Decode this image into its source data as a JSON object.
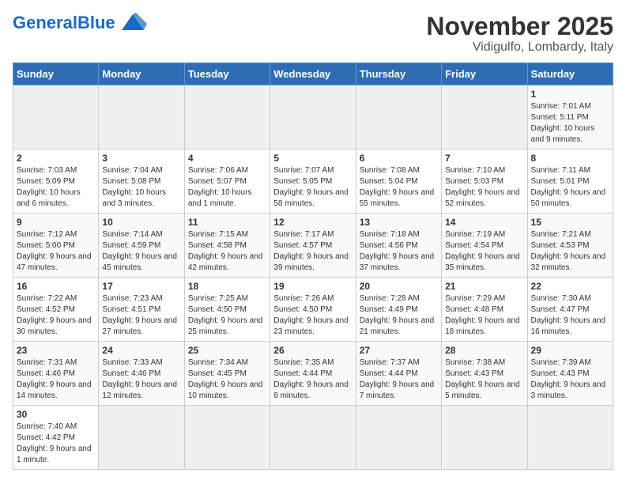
{
  "header": {
    "logo_general": "General",
    "logo_blue": "Blue",
    "title": "November 2025",
    "subtitle": "Vidigulfo, Lombardy, Italy"
  },
  "weekdays": [
    "Sunday",
    "Monday",
    "Tuesday",
    "Wednesday",
    "Thursday",
    "Friday",
    "Saturday"
  ],
  "weeks": [
    [
      {
        "day": "",
        "info": ""
      },
      {
        "day": "",
        "info": ""
      },
      {
        "day": "",
        "info": ""
      },
      {
        "day": "",
        "info": ""
      },
      {
        "day": "",
        "info": ""
      },
      {
        "day": "",
        "info": ""
      },
      {
        "day": "1",
        "info": "Sunrise: 7:01 AM\nSunset: 5:11 PM\nDaylight: 10 hours and 9 minutes."
      }
    ],
    [
      {
        "day": "2",
        "info": "Sunrise: 7:03 AM\nSunset: 5:09 PM\nDaylight: 10 hours and 6 minutes."
      },
      {
        "day": "3",
        "info": "Sunrise: 7:04 AM\nSunset: 5:08 PM\nDaylight: 10 hours and 3 minutes."
      },
      {
        "day": "4",
        "info": "Sunrise: 7:06 AM\nSunset: 5:07 PM\nDaylight: 10 hours and 1 minute."
      },
      {
        "day": "5",
        "info": "Sunrise: 7:07 AM\nSunset: 5:05 PM\nDaylight: 9 hours and 58 minutes."
      },
      {
        "day": "6",
        "info": "Sunrise: 7:08 AM\nSunset: 5:04 PM\nDaylight: 9 hours and 55 minutes."
      },
      {
        "day": "7",
        "info": "Sunrise: 7:10 AM\nSunset: 5:03 PM\nDaylight: 9 hours and 52 minutes."
      },
      {
        "day": "8",
        "info": "Sunrise: 7:11 AM\nSunset: 5:01 PM\nDaylight: 9 hours and 50 minutes."
      }
    ],
    [
      {
        "day": "9",
        "info": "Sunrise: 7:12 AM\nSunset: 5:00 PM\nDaylight: 9 hours and 47 minutes."
      },
      {
        "day": "10",
        "info": "Sunrise: 7:14 AM\nSunset: 4:59 PM\nDaylight: 9 hours and 45 minutes."
      },
      {
        "day": "11",
        "info": "Sunrise: 7:15 AM\nSunset: 4:58 PM\nDaylight: 9 hours and 42 minutes."
      },
      {
        "day": "12",
        "info": "Sunrise: 7:17 AM\nSunset: 4:57 PM\nDaylight: 9 hours and 39 minutes."
      },
      {
        "day": "13",
        "info": "Sunrise: 7:18 AM\nSunset: 4:56 PM\nDaylight: 9 hours and 37 minutes."
      },
      {
        "day": "14",
        "info": "Sunrise: 7:19 AM\nSunset: 4:54 PM\nDaylight: 9 hours and 35 minutes."
      },
      {
        "day": "15",
        "info": "Sunrise: 7:21 AM\nSunset: 4:53 PM\nDaylight: 9 hours and 32 minutes."
      }
    ],
    [
      {
        "day": "16",
        "info": "Sunrise: 7:22 AM\nSunset: 4:52 PM\nDaylight: 9 hours and 30 minutes."
      },
      {
        "day": "17",
        "info": "Sunrise: 7:23 AM\nSunset: 4:51 PM\nDaylight: 9 hours and 27 minutes."
      },
      {
        "day": "18",
        "info": "Sunrise: 7:25 AM\nSunset: 4:50 PM\nDaylight: 9 hours and 25 minutes."
      },
      {
        "day": "19",
        "info": "Sunrise: 7:26 AM\nSunset: 4:50 PM\nDaylight: 9 hours and 23 minutes."
      },
      {
        "day": "20",
        "info": "Sunrise: 7:28 AM\nSunset: 4:49 PM\nDaylight: 9 hours and 21 minutes."
      },
      {
        "day": "21",
        "info": "Sunrise: 7:29 AM\nSunset: 4:48 PM\nDaylight: 9 hours and 18 minutes."
      },
      {
        "day": "22",
        "info": "Sunrise: 7:30 AM\nSunset: 4:47 PM\nDaylight: 9 hours and 16 minutes."
      }
    ],
    [
      {
        "day": "23",
        "info": "Sunrise: 7:31 AM\nSunset: 4:46 PM\nDaylight: 9 hours and 14 minutes."
      },
      {
        "day": "24",
        "info": "Sunrise: 7:33 AM\nSunset: 4:46 PM\nDaylight: 9 hours and 12 minutes."
      },
      {
        "day": "25",
        "info": "Sunrise: 7:34 AM\nSunset: 4:45 PM\nDaylight: 9 hours and 10 minutes."
      },
      {
        "day": "26",
        "info": "Sunrise: 7:35 AM\nSunset: 4:44 PM\nDaylight: 9 hours and 8 minutes."
      },
      {
        "day": "27",
        "info": "Sunrise: 7:37 AM\nSunset: 4:44 PM\nDaylight: 9 hours and 7 minutes."
      },
      {
        "day": "28",
        "info": "Sunrise: 7:38 AM\nSunset: 4:43 PM\nDaylight: 9 hours and 5 minutes."
      },
      {
        "day": "29",
        "info": "Sunrise: 7:39 AM\nSunset: 4:43 PM\nDaylight: 9 hours and 3 minutes."
      }
    ],
    [
      {
        "day": "30",
        "info": "Sunrise: 7:40 AM\nSunset: 4:42 PM\nDaylight: 9 hours and 1 minute."
      },
      {
        "day": "",
        "info": ""
      },
      {
        "day": "",
        "info": ""
      },
      {
        "day": "",
        "info": ""
      },
      {
        "day": "",
        "info": ""
      },
      {
        "day": "",
        "info": ""
      },
      {
        "day": "",
        "info": ""
      }
    ]
  ]
}
